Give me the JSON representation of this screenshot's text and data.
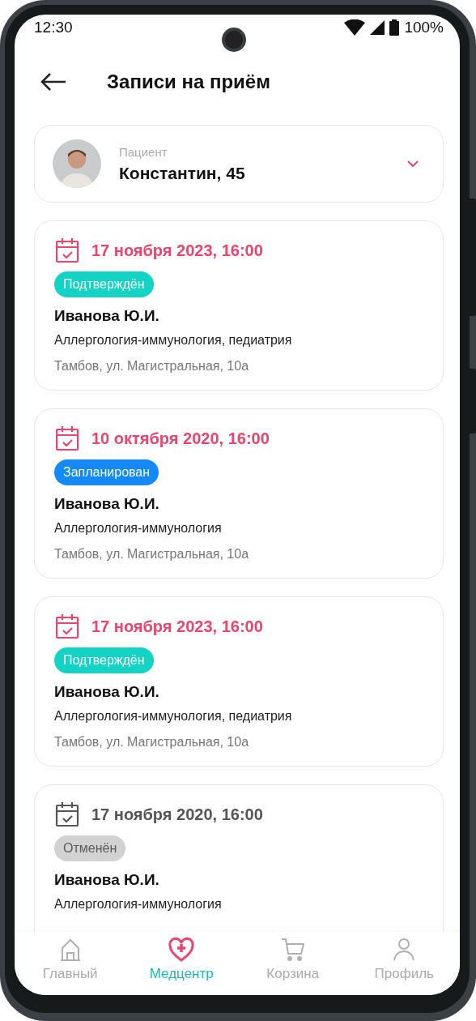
{
  "status_bar": {
    "time": "12:30",
    "battery": "100%"
  },
  "header": {
    "title": "Записи на приём"
  },
  "patient": {
    "label": "Пациент",
    "name": "Константин, 45"
  },
  "appointments": [
    {
      "date": "17 ноября 2023, 16:00",
      "status": {
        "kind": "confirmed",
        "label": "Подтверждён"
      },
      "doctor": "Иванова Ю.И.",
      "specialty": "Аллергология-иммунология, педиатрия",
      "address": "Тамбов, ул. Магистральная, 10а"
    },
    {
      "date": "10 октября 2020, 16:00",
      "status": {
        "kind": "planned",
        "label": "Запланирован"
      },
      "doctor": "Иванова Ю.И.",
      "specialty": "Аллергология-иммунология",
      "address": "Тамбов, ул. Магистральная, 10а"
    },
    {
      "date": "17 ноября 2023, 16:00",
      "status": {
        "kind": "confirmed",
        "label": "Подтверждён"
      },
      "doctor": "Иванова Ю.И.",
      "specialty": "Аллергология-иммунология, педиатрия",
      "address": "Тамбов, ул. Магистральная, 10а"
    },
    {
      "date": "17 ноября 2020, 16:00",
      "status": {
        "kind": "cancelled",
        "label": "Отменён"
      },
      "doctor": "Иванова Ю.И.",
      "specialty": "Аллергология-иммунология"
    }
  ],
  "nav": [
    {
      "kind": "home",
      "label": "Главный",
      "selected": false
    },
    {
      "kind": "medcenter",
      "label": "Медцентр",
      "selected": true
    },
    {
      "kind": "cart",
      "label": "Корзина",
      "selected": false
    },
    {
      "kind": "profile",
      "label": "Профиль",
      "selected": false
    }
  ]
}
